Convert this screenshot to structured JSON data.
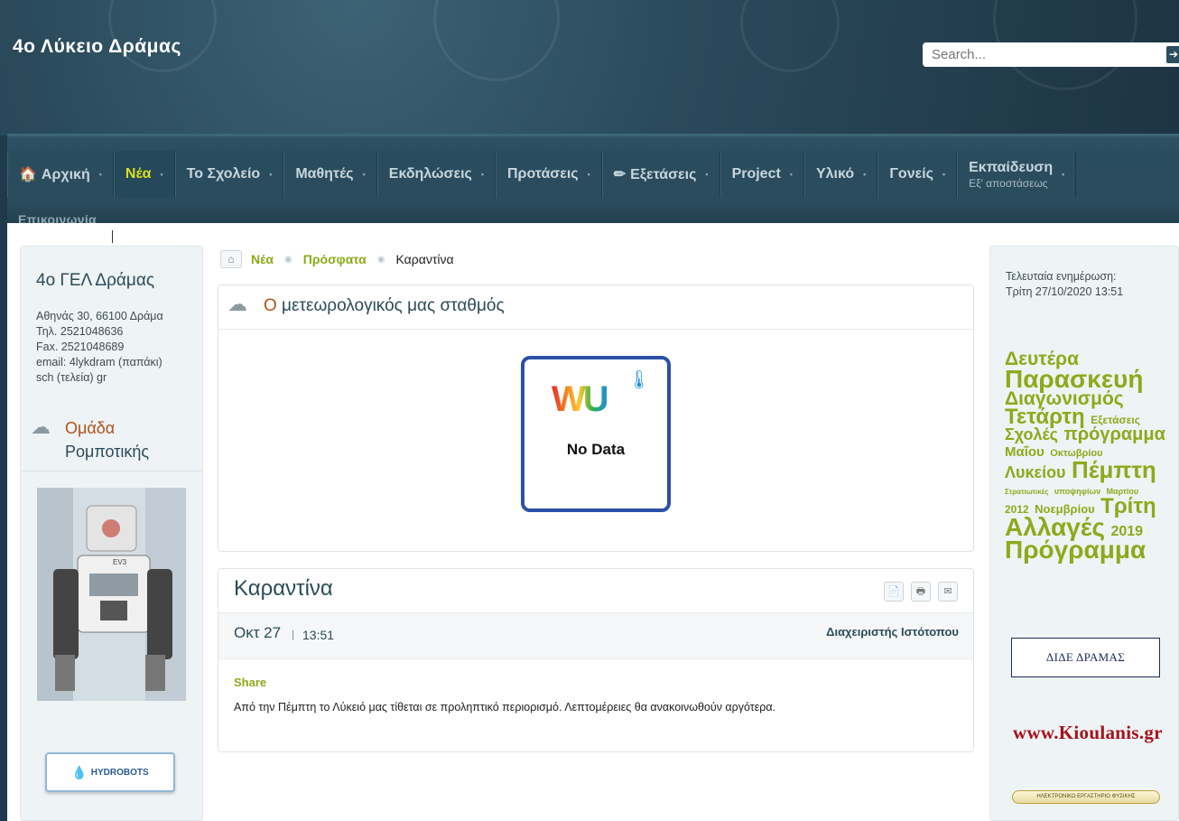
{
  "header": {
    "site_title": "4ο Λύκειο Δράμας",
    "search_placeholder": "Search...",
    "search_button": "➔"
  },
  "nav": {
    "items": [
      {
        "label": "Αρχική",
        "icon": "home-icon",
        "glyph": "🏠"
      },
      {
        "label": "Νέα",
        "active": true
      },
      {
        "label": "Το Σχολείο"
      },
      {
        "label": "Μαθητές"
      },
      {
        "label": "Εκδηλώσεις"
      },
      {
        "label": "Προτάσεις"
      },
      {
        "label": "Εξετάσεις",
        "icon": "pencil-icon",
        "glyph": "✏"
      },
      {
        "label": "Project"
      },
      {
        "label": "Υλικό"
      },
      {
        "label": "Γονείς"
      },
      {
        "label": "Εκπαίδευση",
        "sub": "Εξ' αποστάσεως"
      }
    ],
    "second_row": "Επικοινωνία",
    "dot": "•"
  },
  "left": {
    "school_name": "4ο ΓΕΛ Δράμας",
    "address": "Αθηνάς 30, 66100 Δράμα",
    "tel": "Τηλ. 2521048636",
    "fax": "Fax. 2521048689",
    "email1": "email: 4lykdram (παπάκι)",
    "email2": "sch (τελεία) gr",
    "robotics_title_1": "Ομάδα",
    "robotics_title_2": "Ρομποτικής",
    "hydro_label": "HYDROBOTS",
    "robot_screen": "EV3"
  },
  "breadcrumb": {
    "home_icon": "home-icon",
    "items": [
      "Νέα",
      "Πρόσφατα"
    ],
    "current": "Καραντίνα",
    "sep": "◉"
  },
  "weather": {
    "title_o": "Ο",
    "title_rest": " μετεωρολογικός μας σταθμός",
    "logo": "WU",
    "no_data": "No Data"
  },
  "article": {
    "title": "Καραντίνα",
    "actions": [
      {
        "name": "pdf-icon",
        "glyph": "📄"
      },
      {
        "name": "print-icon",
        "glyph": "🖶"
      },
      {
        "name": "email-icon",
        "glyph": "✉"
      }
    ],
    "date": "Οκτ 27",
    "separator": "|",
    "time": "13:51",
    "author": "Διαχειριστής Ιστότοπου",
    "share": "Share",
    "body": "Από την Πέμπτη το Λύκειό μας τίθεται σε προληπτικό περιορισμό. Λεπτομέρειες θα ανακοινωθούν αργότερα."
  },
  "right": {
    "last_update_label": "Τελευταία ενημέρωση:",
    "last_update_value": "Τρίτη 27/10/2020 13:51",
    "tags": [
      {
        "t": "Δευτέρα",
        "s": 21
      },
      {
        "t": "Παρασκευή",
        "s": 28
      },
      {
        "t": "Διαγωνισμός",
        "s": 21
      },
      {
        "t": "Τετάρτη",
        "s": 24
      },
      {
        "t": "Εξετάσεις",
        "s": 12
      },
      {
        "t": "Σχολές",
        "s": 18
      },
      {
        "t": "πρόγραμμα",
        "s": 20
      },
      {
        "t": "Μαΐου",
        "s": 15
      },
      {
        "t": "Οκτωβρίου",
        "s": 11
      },
      {
        "t": "Λυκείου",
        "s": 18
      },
      {
        "t": "Πέμπτη",
        "s": 26
      },
      {
        "t": "Στρατιωτικές",
        "s": 8
      },
      {
        "t": "υποψηφίων",
        "s": 9
      },
      {
        "t": "Μαρτίου",
        "s": 9
      },
      {
        "t": "2012",
        "s": 12
      },
      {
        "t": "Νοεμβρίου",
        "s": 13
      },
      {
        "t": "Τρίτη",
        "s": 24
      },
      {
        "t": "Αλλαγές",
        "s": 28
      },
      {
        "t": "2019",
        "s": 16
      },
      {
        "t": "Πρόγραμμα",
        "s": 28
      }
    ],
    "dide": "ΔΙΔΕ ΔΡΑΜΑΣ",
    "kioulanis": "www.Kioulanis.gr",
    "lab": "ΗΛΕΚΤΡΟΝΙΚΟ ΕΡΓΑΣΤΗΡΙΟ ΦΥΣΙΚΗΣ"
  }
}
